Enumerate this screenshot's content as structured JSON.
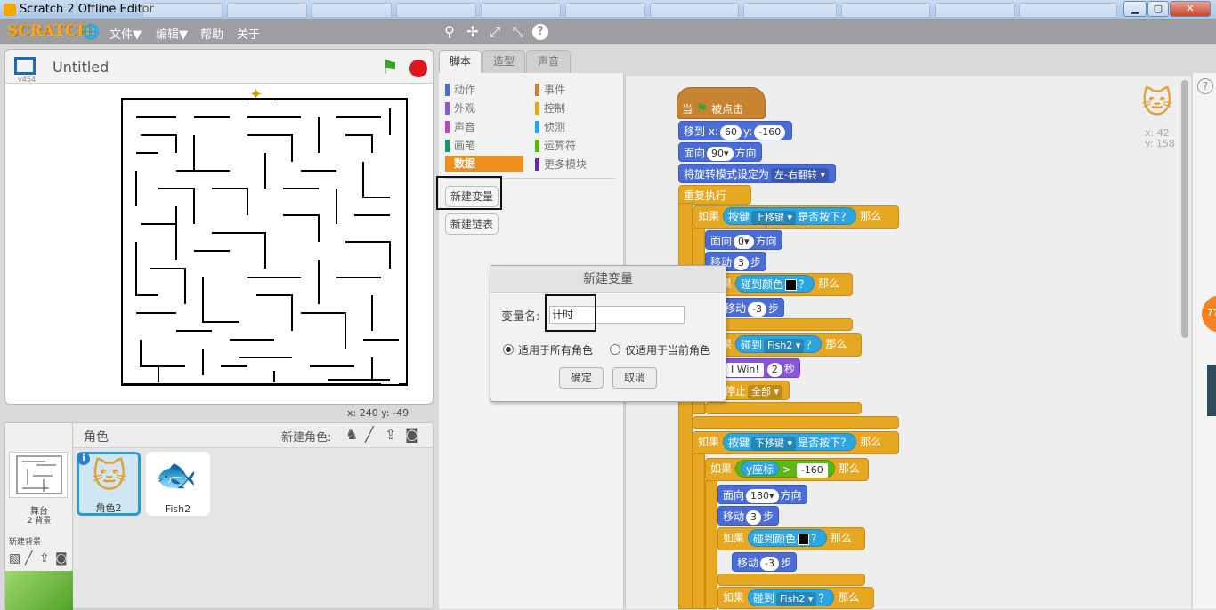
{
  "window": {
    "title": "Scratch 2 Offline Editor"
  },
  "menubar": {
    "logo": "SCRATCH",
    "file": "文件▼",
    "edit": "编辑▼",
    "help": "帮助",
    "about": "关于"
  },
  "stage": {
    "title": "Untitled",
    "version": "v454",
    "coords": "x:  240   y:  -49"
  },
  "sprites": {
    "header": "角色",
    "new_sprite": "新建角色:",
    "stage_label": "舞台",
    "stage_backdrops": "2 背景",
    "new_backdrop": "新建背景",
    "items": [
      {
        "name": "角色2"
      },
      {
        "name": "Fish2"
      }
    ]
  },
  "tabs": {
    "scripts": "脚本",
    "costumes": "造型",
    "sounds": "声音"
  },
  "categories": {
    "motion": "动作",
    "looks": "外观",
    "sound": "声音",
    "pen": "画笔",
    "data": "数据",
    "events": "事件",
    "control": "控制",
    "sensing": "侦测",
    "operators": "运算符",
    "more": "更多模块"
  },
  "palette": {
    "make_variable": "新建变量",
    "make_list": "新建链表"
  },
  "script_area": {
    "sprite_x": "x: 42",
    "sprite_y": "y: 158",
    "side_badge": "77"
  },
  "script": {
    "hat_when": "当",
    "hat_clicked": "被点击",
    "goto_label": "移到 x:",
    "goto_x": "60",
    "goto_y_label": "y:",
    "goto_y": "-160",
    "point_label": "面向",
    "point_val": "90▾",
    "point_dir": "方向",
    "rotation_label": "将旋转模式设定为",
    "rotation_val": "左-右翻转",
    "forever": "重复执行",
    "if": "如果",
    "then": "那么",
    "key_label": "按键",
    "key_up": "上移键",
    "key_down": "下移键",
    "pressed": "是否按下？",
    "dir_0": "0▾",
    "dir_180": "180▾",
    "move": "移动",
    "three": "3",
    "neg3": "-3",
    "steps": "步",
    "touch_color": "碰到颜色",
    "q": "？",
    "touch": "碰到",
    "fish2": "Fish2",
    "say_win": "I Win!",
    "say_secs": "2",
    "sec": "秒",
    "stop_label": "停止",
    "stop_all": "全部",
    "ycoord": "y座标",
    "gt": ">",
    "ylimit": "-160"
  },
  "dialog": {
    "title": "新建变量",
    "name_label": "变量名:",
    "name_value": "计时",
    "opt_all": "适用于所有角色",
    "opt_this": "仅适用于当前角色",
    "ok": "确定",
    "cancel": "取消"
  }
}
